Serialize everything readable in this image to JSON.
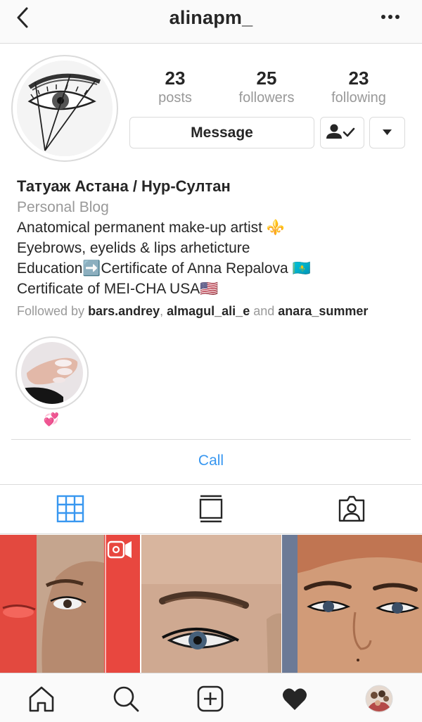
{
  "header": {
    "username": "alinapm_",
    "back_icon": "chevron-left-icon",
    "more_icon": "more-horizontal-icon"
  },
  "stats": {
    "posts": {
      "count": "23",
      "label": "posts"
    },
    "followers": {
      "count": "25",
      "label": "followers"
    },
    "following": {
      "count": "23",
      "label": "following"
    }
  },
  "actions": {
    "message_label": "Message",
    "following_icon": "user-check-icon",
    "dropdown_icon": "caret-down-icon"
  },
  "bio": {
    "name": "Татуаж Астана / Нур-Султан",
    "category": "Personal Blog",
    "lines": [
      "Anatomical permanent make-up artist ⚜️",
      "Eyebrows, eyelids & lips arhetiсture",
      "Education➡️Certificate of Anna Repalova 🇰🇿",
      "Certificate of MEI-CHA USA🇺🇸"
    ],
    "followed_by_prefix": "Followed by",
    "followed_by": [
      "bars.andrey",
      "almagul_ali_e",
      "anara_summer"
    ],
    "followed_by_and": "and"
  },
  "highlight": {
    "label": "💞"
  },
  "call_label": "Call",
  "tabs": [
    "grid-icon",
    "feed-icon",
    "tagged-icon"
  ],
  "grid_posts": [
    {
      "type": "video",
      "badge": "igtv-icon"
    },
    {
      "type": "photo"
    },
    {
      "type": "photo"
    }
  ],
  "bottom_nav": [
    "home-icon",
    "search-icon",
    "add-post-icon",
    "heart-icon",
    "profile-avatar"
  ],
  "colors": {
    "link_blue": "#3897f0",
    "secondary_text": "#999999",
    "border": "#dbdbdb",
    "accent_red": "#e8473f"
  }
}
